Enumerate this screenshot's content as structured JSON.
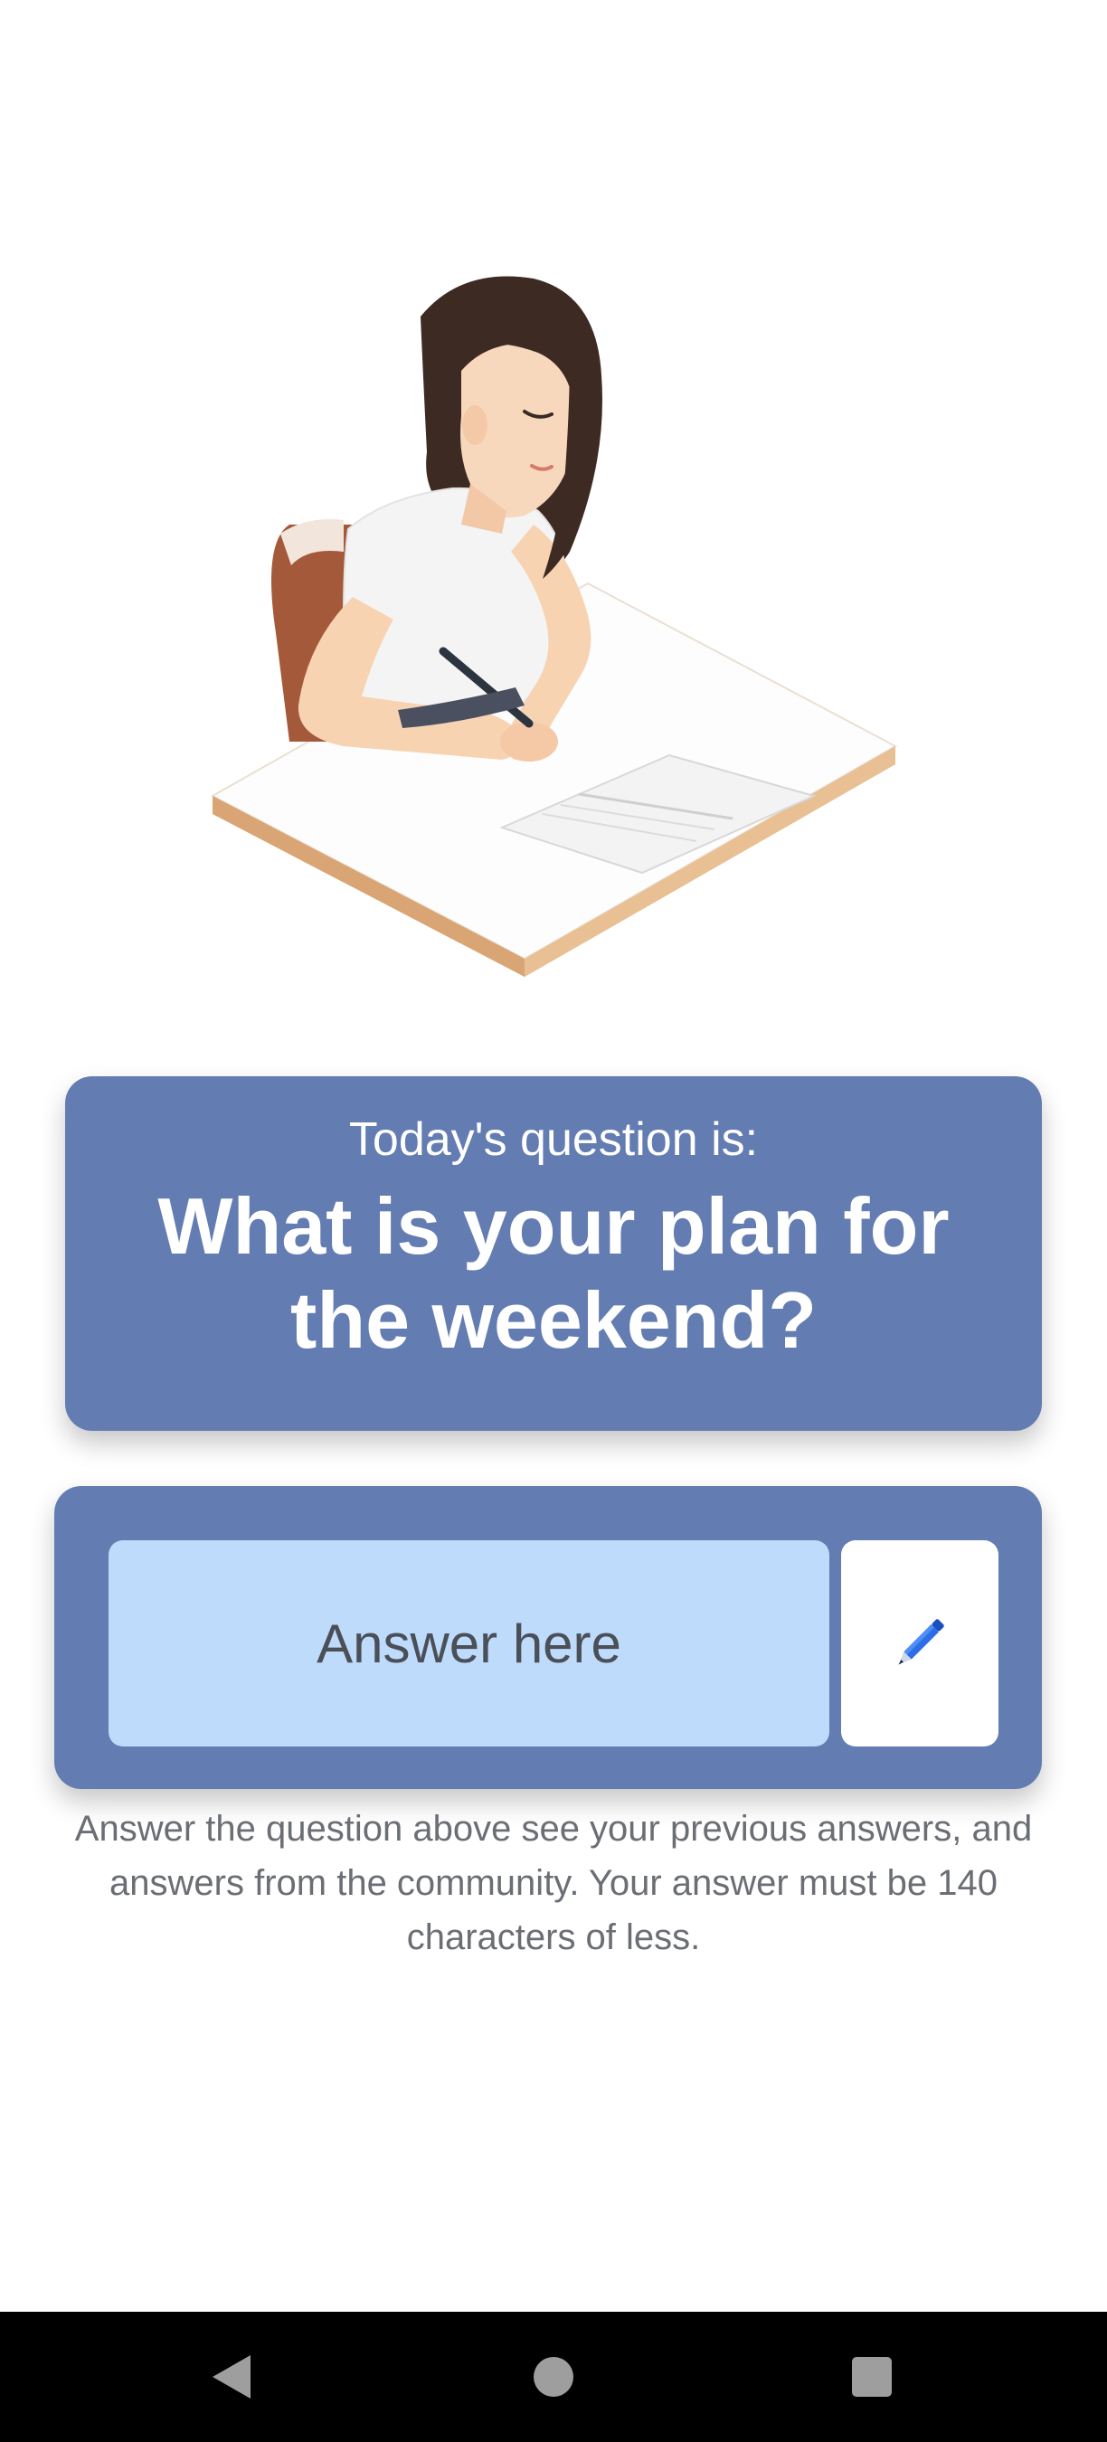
{
  "question_card": {
    "prefix": "Today's question is:",
    "question": "What is your plan for the weekend?"
  },
  "answer_card": {
    "input_placeholder": "Answer here",
    "input_value": "",
    "submit_icon": "pencil-icon"
  },
  "help_text": "Answer the question above see your previous answers, and answers from the community. Your answer must be 140 characters of less.",
  "illustration": {
    "subject": "woman-writing-illustration"
  },
  "nav_bar": {
    "back_icon": "back-triangle-icon",
    "home_icon": "home-circle-icon",
    "recents_icon": "recents-square-icon"
  },
  "colors": {
    "card": "#637cb1",
    "input_background": "#bfdbfb",
    "help_text": "#6b6e74",
    "nav_bar": "#000000"
  }
}
